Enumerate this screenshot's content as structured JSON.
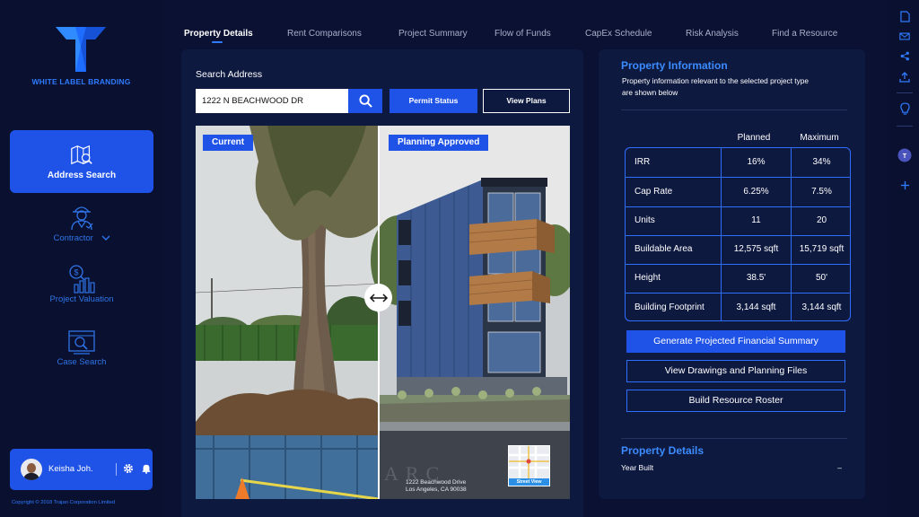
{
  "sidebar": {
    "brand": "WHITE LABEL BRANDING",
    "items": [
      {
        "label": "Address Search",
        "icon": "map-search-icon",
        "active": true
      },
      {
        "label": "Contractor",
        "icon": "contractor-icon",
        "active": false
      },
      {
        "label": "Project Valuation",
        "icon": "valuation-chart-icon",
        "active": false
      },
      {
        "label": "Case Search",
        "icon": "case-search-icon",
        "active": false
      }
    ],
    "user": {
      "name": "Keisha Joh."
    },
    "copyright": "Copyright © 2018 Trajan Corporation Limited"
  },
  "tabs": [
    {
      "label": "Property Details",
      "active": true
    },
    {
      "label": "Rent Comparisons",
      "active": false
    },
    {
      "label": "Project Summary",
      "active": false
    },
    {
      "label": "Flow of Funds",
      "active": false
    },
    {
      "label": "CapEx Schedule",
      "active": false
    },
    {
      "label": "Risk Analysis",
      "active": false
    },
    {
      "label": "Find a Resource",
      "active": false
    }
  ],
  "search": {
    "title": "Search Address",
    "value": "1222 N BEACHWOOD DR",
    "permit_label": "Permit Status",
    "plans_label": "View Plans"
  },
  "compare": {
    "left_label": "Current",
    "right_label": "Planning Approved",
    "address_line1": "1222 Beachwood Drive",
    "address_line2": "Los Angeles, CA 90038",
    "street_view_label": "Street View"
  },
  "info": {
    "title": "Property Information",
    "description": "Property information relevant to the selected project type are shown below",
    "col_planned": "Planned",
    "col_maximum": "Maximum",
    "rows": [
      {
        "metric": "IRR",
        "planned": "16%",
        "maximum": "34%"
      },
      {
        "metric": "Cap Rate",
        "planned": "6.25%",
        "maximum": "7.5%"
      },
      {
        "metric": "Units",
        "planned": "11",
        "maximum": "20"
      },
      {
        "metric": "Buildable Area",
        "planned": "12,575 sqft",
        "maximum": "15,719 sqft"
      },
      {
        "metric": "Height",
        "planned": "38.5'",
        "maximum": "50'"
      },
      {
        "metric": "Building Footprint",
        "planned": "3,144 sqft",
        "maximum": "3,144 sqft"
      }
    ],
    "actions": {
      "generate": "Generate Projected Financial Summary",
      "drawings": "View Drawings and Planning Files",
      "roster": "Build Resource Roster"
    }
  },
  "property_details": {
    "title": "Property Details",
    "rows": [
      {
        "label": "Year Built",
        "value": "–"
      }
    ]
  },
  "rail_icons": [
    "document-icon",
    "mail-icon",
    "share-icon",
    "upload-icon",
    "lightbulb-icon",
    "teams-icon",
    "plus-icon"
  ],
  "colors": {
    "background": "#0b1133",
    "panel": "#0e1940",
    "accent": "#1f52e6",
    "link_blue": "#3b8cff"
  }
}
